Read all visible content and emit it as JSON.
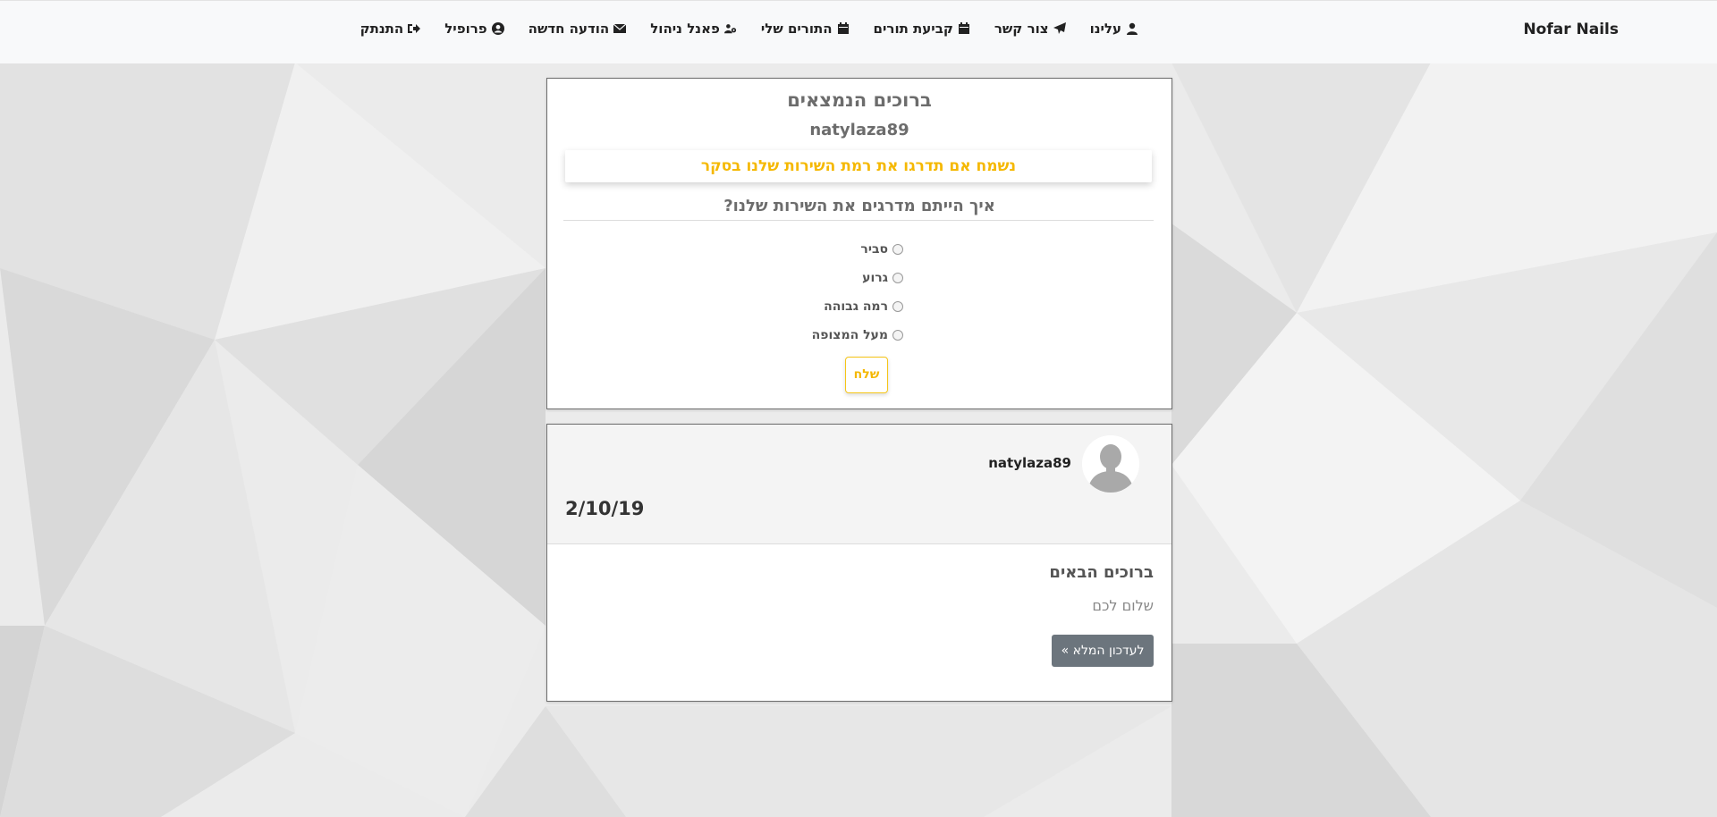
{
  "navbar": {
    "brand": "Nofar Nails",
    "items": [
      {
        "label": "עלינו",
        "icon": "user-icon"
      },
      {
        "label": "צור קשר",
        "icon": "paper-plane-icon"
      },
      {
        "label": "קביעת תורים",
        "icon": "calendar-icon"
      },
      {
        "label": "התורים שלי",
        "icon": "calendar-icon"
      },
      {
        "label": "פאנל ניהול",
        "icon": "users-cog-icon"
      },
      {
        "label": "הודעה חדשה",
        "icon": "envelope-icon"
      },
      {
        "label": "פרופיל",
        "icon": "user-circle-icon"
      },
      {
        "label": "התנתק",
        "icon": "sign-out-icon"
      }
    ]
  },
  "survey": {
    "title": "ברוכים הנמצאים",
    "username": "natylaza89",
    "banner": "נשמח אם תדרגו את רמת השירות שלנו בסקר",
    "question": "איך הייתם מדרגים את השירות שלנו?",
    "options": [
      "סביר",
      "גרוע",
      "רמה גבוהה",
      "מעל המצופה"
    ],
    "submit_label": "שלח"
  },
  "post": {
    "username": "natylaza89",
    "date": "2/10/19",
    "title": "ברוכים הבאים",
    "body": "שלום לכם",
    "read_more_label": "לעדכון המלא »"
  },
  "colors": {
    "accent": "#f5b800",
    "secondary_button": "#6c757d"
  }
}
